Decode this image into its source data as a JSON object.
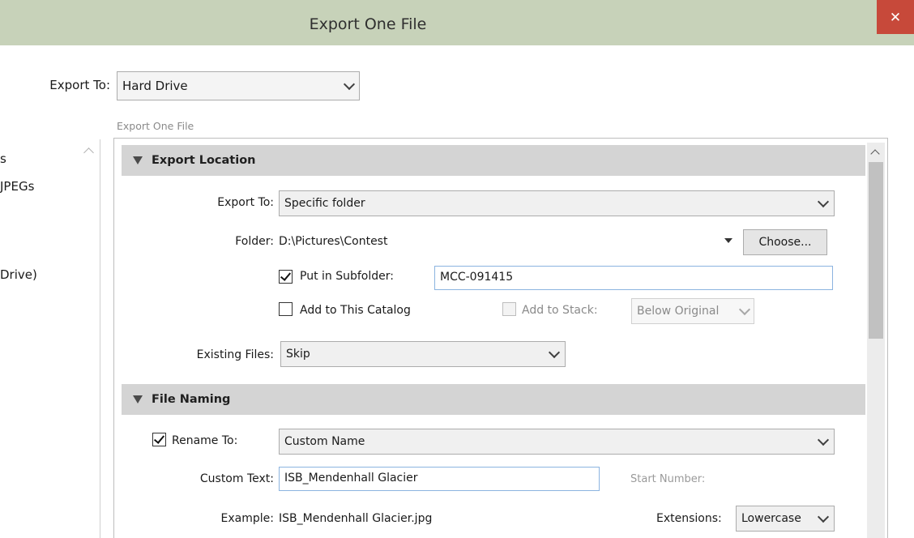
{
  "window": {
    "title": "Export One File",
    "close_glyph": "✕"
  },
  "export_to_top": {
    "label": "Export To:",
    "value": "Hard Drive"
  },
  "panel_caption": "Export One File",
  "left_list": {
    "items": [
      "s",
      "JPEGs",
      "Drive)"
    ]
  },
  "export_location": {
    "header": "Export Location",
    "export_to_label": "Export To:",
    "export_to_value": "Specific folder",
    "folder_label": "Folder:",
    "folder_value": "D:\\Pictures\\Contest",
    "choose_label": "Choose...",
    "subfolder_label": "Put in Subfolder:",
    "subfolder_checked": true,
    "subfolder_value": "MCC-091415",
    "add_catalog_label": "Add to This Catalog",
    "add_catalog_checked": false,
    "add_stack_label": "Add to Stack:",
    "add_stack_value": "Below Original",
    "existing_files_label": "Existing Files:",
    "existing_files_value": "Skip"
  },
  "file_naming": {
    "header": "File Naming",
    "rename_label": "Rename To:",
    "rename_checked": true,
    "rename_value": "Custom Name",
    "custom_text_label": "Custom Text:",
    "custom_text_value": "ISB_Mendenhall Glacier",
    "start_number_label": "Start Number:",
    "example_label": "Example:",
    "example_value": "ISB_Mendenhall Glacier.jpg",
    "extensions_label": "Extensions:",
    "extensions_value": "Lowercase"
  },
  "colors": {
    "title_bar": "#c7d2b9",
    "close_button": "#c7493a",
    "section_header": "#d4d4d4",
    "input_border": "#8cb4e0"
  }
}
